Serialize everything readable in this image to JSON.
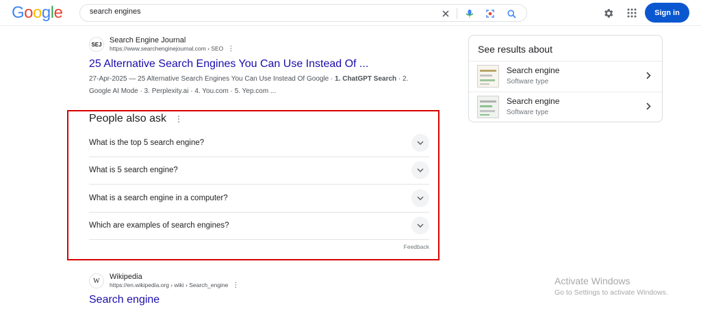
{
  "header": {
    "logo_letters": [
      {
        "ch": "G",
        "color": "#4285f4"
      },
      {
        "ch": "o",
        "color": "#ea4335"
      },
      {
        "ch": "o",
        "color": "#fbbc05"
      },
      {
        "ch": "g",
        "color": "#4285f4"
      },
      {
        "ch": "l",
        "color": "#34a853"
      },
      {
        "ch": "e",
        "color": "#ea4335"
      }
    ],
    "search_query": "search engines",
    "sign_in_label": "Sign in"
  },
  "results": [
    {
      "site_name": "Search Engine Journal",
      "favicon_text": "SEJ",
      "url": "https://www.searchenginejournal.com › SEO",
      "title": "25 Alternative Search Engines You Can Use Instead Of ...",
      "snippet_lead": "27-Apr-2025 — 25 Alternative Search Engines You Can Use Instead Of Google · ",
      "snippet_bold": "1. ChatGPT Search",
      "snippet_tail": " · 2. Google AI Mode · 3. Perplexity.ai · 4. You.com · 5. Yep.com ..."
    },
    {
      "site_name": "Wikipedia",
      "favicon_text": "W",
      "url": "https://en.wikipedia.org › wiki › Search_engine",
      "title": "Search engine"
    }
  ],
  "people_also_ask": {
    "title": "People also ask",
    "questions": [
      "What is the top 5 search engine?",
      "What is 5 search engine?",
      "What is a search engine in a computer?",
      "Which are examples of search engines?"
    ],
    "feedback_label": "Feedback"
  },
  "side_panel": {
    "title": "See results about",
    "items": [
      {
        "title": "Search engine",
        "subtitle": "Software type"
      },
      {
        "title": "Search engine",
        "subtitle": "Software type"
      }
    ]
  },
  "watermark": {
    "title": "Activate Windows",
    "subtitle": "Go to Settings to activate Windows."
  },
  "colors": {
    "link": "#1a0dab",
    "brand_blue": "#0b57d0",
    "highlight_border": "#d80000"
  }
}
